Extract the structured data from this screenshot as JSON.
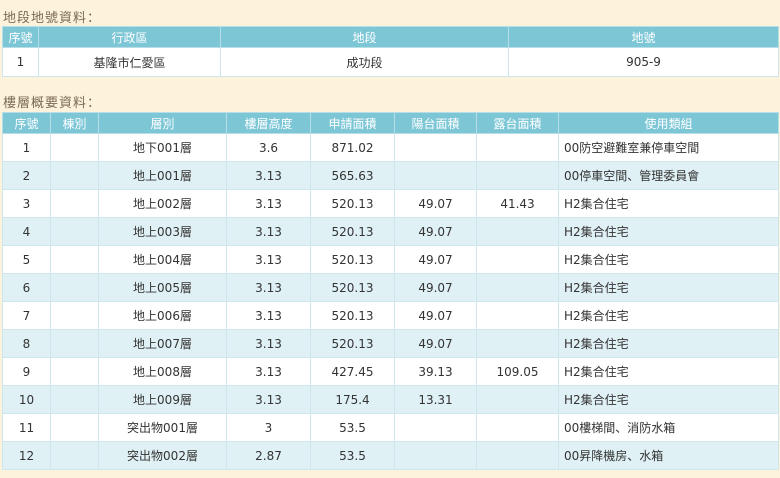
{
  "land_section": {
    "title": "地段地號資料：",
    "headers": [
      "序號",
      "行政區",
      "地段",
      "地號"
    ],
    "rows": [
      [
        "1",
        "基隆市仁愛區",
        "成功段",
        "905-9"
      ]
    ]
  },
  "floor_section": {
    "title": "樓層概要資料：",
    "headers": [
      "序號",
      "棟別",
      "層別",
      "樓層高度",
      "申請面積",
      "陽台面積",
      "露台面積",
      "使用類組"
    ],
    "rows": [
      [
        "1",
        "",
        "地下001層",
        "3.6",
        "871.02",
        "",
        "",
        "00防空避難室兼停車空間"
      ],
      [
        "2",
        "",
        "地上001層",
        "3.13",
        "565.63",
        "",
        "",
        "00停車空間、管理委員會"
      ],
      [
        "3",
        "",
        "地上002層",
        "3.13",
        "520.13",
        "49.07",
        "41.43",
        "H2集合住宅"
      ],
      [
        "4",
        "",
        "地上003層",
        "3.13",
        "520.13",
        "49.07",
        "",
        "H2集合住宅"
      ],
      [
        "5",
        "",
        "地上004層",
        "3.13",
        "520.13",
        "49.07",
        "",
        "H2集合住宅"
      ],
      [
        "6",
        "",
        "地上005層",
        "3.13",
        "520.13",
        "49.07",
        "",
        "H2集合住宅"
      ],
      [
        "7",
        "",
        "地上006層",
        "3.13",
        "520.13",
        "49.07",
        "",
        "H2集合住宅"
      ],
      [
        "8",
        "",
        "地上007層",
        "3.13",
        "520.13",
        "49.07",
        "",
        "H2集合住宅"
      ],
      [
        "9",
        "",
        "地上008層",
        "3.13",
        "427.45",
        "39.13",
        "109.05",
        "H2集合住宅"
      ],
      [
        "10",
        "",
        "地上009層",
        "3.13",
        "175.4",
        "13.31",
        "",
        "H2集合住宅"
      ],
      [
        "11",
        "",
        "突出物001層",
        "3",
        "53.5",
        "",
        "",
        "00樓梯間、消防水箱"
      ],
      [
        "12",
        "",
        "突出物002層",
        "2.87",
        "53.5",
        "",
        "",
        "00昇降機房、水箱"
      ]
    ]
  },
  "colors": {
    "page_background": "#fdf3dc",
    "header_background": "#7cc6d6",
    "alt_row_background": "#e0f1f5"
  }
}
